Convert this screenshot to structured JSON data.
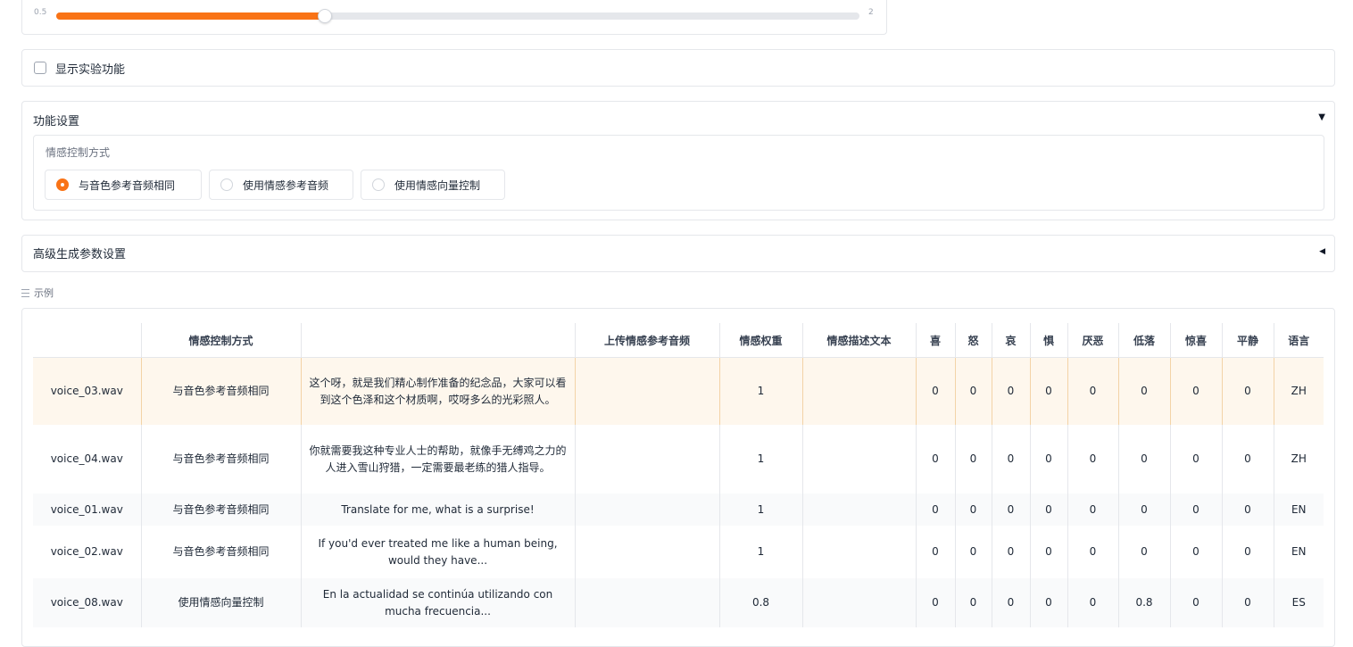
{
  "speed_slider": {
    "min_label": "0.5",
    "max_label": "2",
    "value_fraction": 0.334
  },
  "experimental": {
    "label": "显示实验功能",
    "checked": false
  },
  "feature_settings": {
    "title": "功能设置",
    "arrow": "▼",
    "emotion_control": {
      "title": "情感控制方式",
      "options": [
        "与音色参考音频相同",
        "使用情感参考音频",
        "使用情感向量控制"
      ],
      "selected_index": 0
    }
  },
  "advanced": {
    "title": "高级生成参数设置",
    "arrow": "◀"
  },
  "examples": {
    "label": "示例",
    "headers": [
      "",
      "情感控制方式",
      "",
      "上传情感参考音频",
      "情感权重",
      "情感描述文本",
      "喜",
      "怒",
      "哀",
      "惧",
      "厌恶",
      "低落",
      "惊喜",
      "平静",
      "语言"
    ],
    "rows": [
      [
        "voice_03.wav",
        "与音色参考音频相同",
        "这个呀，就是我们精心制作准备的纪念品，大家可以看到这个色泽和这个材质啊，哎呀多么的光彩照人。",
        "",
        "1",
        "",
        "0",
        "0",
        "0",
        "0",
        "0",
        "0",
        "0",
        "0",
        "ZH"
      ],
      [
        "voice_04.wav",
        "与音色参考音频相同",
        "你就需要我这种专业人士的帮助，就像手无缚鸡之力的人进入雪山狩猎，一定需要最老练的猎人指导。",
        "",
        "1",
        "",
        "0",
        "0",
        "0",
        "0",
        "0",
        "0",
        "0",
        "0",
        "ZH"
      ],
      [
        "voice_01.wav",
        "与音色参考音频相同",
        "Translate for me, what is a surprise!",
        "",
        "1",
        "",
        "0",
        "0",
        "0",
        "0",
        "0",
        "0",
        "0",
        "0",
        "EN"
      ],
      [
        "voice_02.wav",
        "与音色参考音频相同",
        "If you'd ever treated me like a human being, would they have...",
        "",
        "1",
        "",
        "0",
        "0",
        "0",
        "0",
        "0",
        "0",
        "0",
        "0",
        "EN"
      ],
      [
        "voice_08.wav",
        "使用情感向量控制",
        "En la actualidad se continúa utilizando con mucha frecuencia...",
        "",
        "0.8",
        "",
        "0",
        "0",
        "0",
        "0",
        "0",
        "0.8",
        "0",
        "0",
        "ES"
      ]
    ]
  },
  "colors": {
    "accent": "#f97316",
    "highlight_row": "#fef7ed",
    "border": "#e5e7eb"
  }
}
